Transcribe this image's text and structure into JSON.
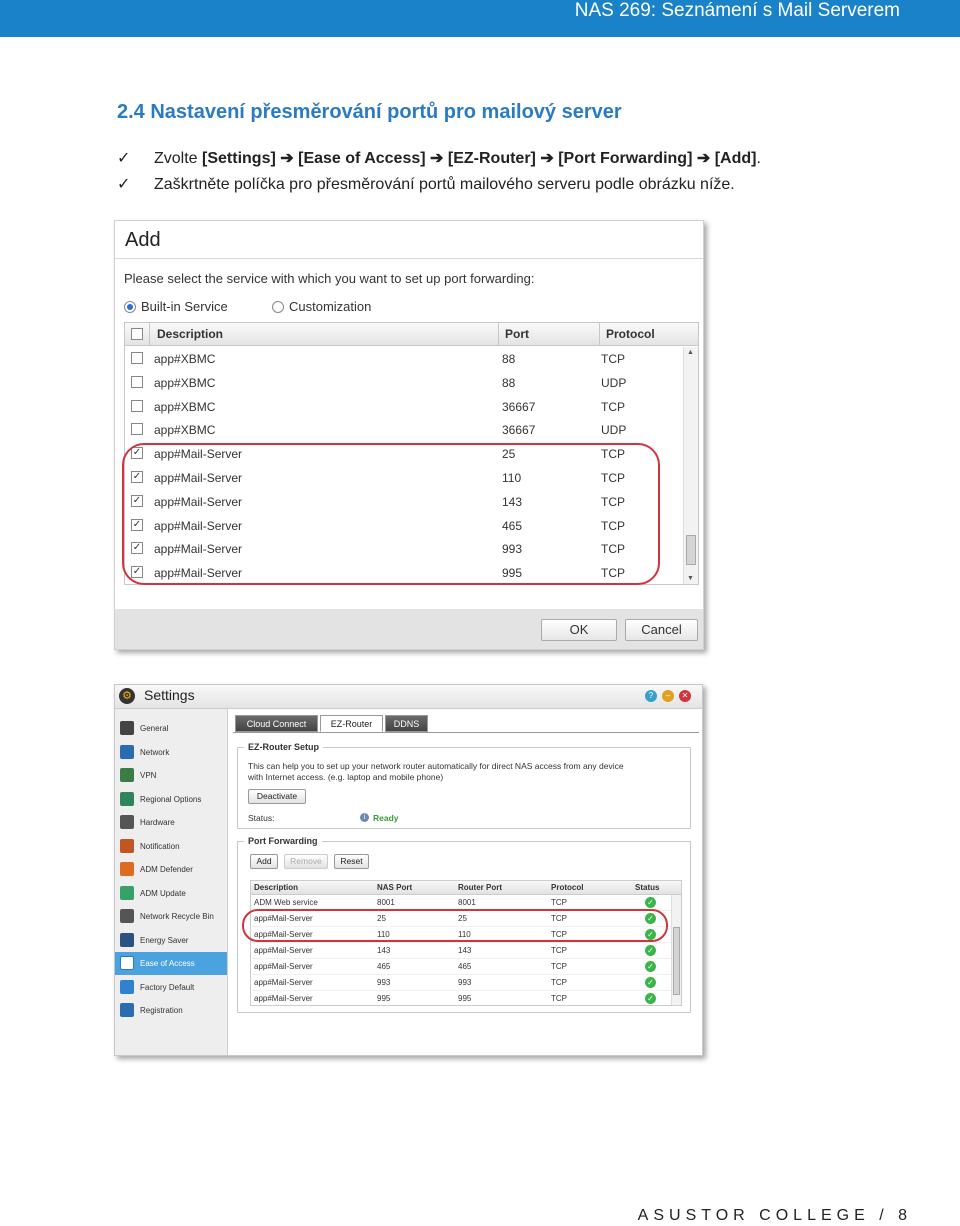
{
  "header": {
    "title": "NAS 269: Seznámení s Mail Serverem"
  },
  "section": {
    "title": "2.4 Nastavení přesměrování portů pro mailový server"
  },
  "bullets": {
    "check_glyph": "✓",
    "b1_prefix": "Zvolte ",
    "b1_settings": "[Settings]",
    "b1_ease": "[Ease of Access]",
    "b1_ez": "[EZ-Router]",
    "b1_pf": "[Port Forwarding]",
    "b1_add": "[Add]",
    "b1_suffix": ".",
    "arrow": "➔",
    "b2": "Zaškrtněte políčka pro přesměrování portů mailového serveru podle obrázku níže."
  },
  "add_dialog": {
    "title": "Add",
    "prompt": "Please select the service with which you want to set up port forwarding:",
    "radio_builtin": "Built-in Service",
    "radio_custom": "Customization",
    "columns": {
      "description": "Description",
      "port": "Port",
      "protocol": "Protocol"
    },
    "rows": [
      {
        "description": "app#XBMC",
        "port": "88",
        "protocol": "TCP",
        "checked": false
      },
      {
        "description": "app#XBMC",
        "port": "88",
        "protocol": "UDP",
        "checked": false
      },
      {
        "description": "app#XBMC",
        "port": "36667",
        "protocol": "TCP",
        "checked": false
      },
      {
        "description": "app#XBMC",
        "port": "36667",
        "protocol": "UDP",
        "checked": false
      },
      {
        "description": "app#Mail-Server",
        "port": "25",
        "protocol": "TCP",
        "checked": true
      },
      {
        "description": "app#Mail-Server",
        "port": "110",
        "protocol": "TCP",
        "checked": true
      },
      {
        "description": "app#Mail-Server",
        "port": "143",
        "protocol": "TCP",
        "checked": true
      },
      {
        "description": "app#Mail-Server",
        "port": "465",
        "protocol": "TCP",
        "checked": true
      },
      {
        "description": "app#Mail-Server",
        "port": "993",
        "protocol": "TCP",
        "checked": true
      },
      {
        "description": "app#Mail-Server",
        "port": "995",
        "protocol": "TCP",
        "checked": true
      }
    ],
    "ok_label": "OK",
    "cancel_label": "Cancel"
  },
  "settings": {
    "title": "Settings",
    "sidebar": [
      {
        "label": "General",
        "color": "#444444"
      },
      {
        "label": "Network",
        "color": "#2b6cb0"
      },
      {
        "label": "VPN",
        "color": "#3a7d44"
      },
      {
        "label": "Regional Options",
        "color": "#2f855a"
      },
      {
        "label": "Hardware",
        "color": "#555555"
      },
      {
        "label": "Notification",
        "color": "#c05621"
      },
      {
        "label": "ADM Defender",
        "color": "#dd6b20"
      },
      {
        "label": "ADM Update",
        "color": "#38a169"
      },
      {
        "label": "Network Recycle Bin",
        "color": "#555555"
      },
      {
        "label": "Energy Saver",
        "color": "#2c5282"
      },
      {
        "label": "Ease of Access",
        "color": "#ffffff"
      },
      {
        "label": "Factory Default",
        "color": "#3182ce"
      },
      {
        "label": "Registration",
        "color": "#2b6cb0"
      }
    ],
    "tabs": [
      "Cloud Connect",
      "EZ-Router",
      "DDNS"
    ],
    "ez_legend": "EZ-Router Setup",
    "ez_desc1": "This can help you to set up your network router automatically for direct NAS access from any device",
    "ez_desc2": "with Internet access. (e.g. laptop and mobile phone)",
    "deactivate_label": "Deactivate",
    "status_label": "Status:",
    "status_value": "Ready",
    "pf_legend": "Port Forwarding",
    "add_label": "Add",
    "remove_label": "Remove",
    "reset_label": "Reset",
    "pf_columns": {
      "description": "Description",
      "nas_port": "NAS Port",
      "router_port": "Router Port",
      "protocol": "Protocol",
      "status": "Status"
    },
    "pf_rows": [
      {
        "description": "ADM Web service",
        "nas_port": "8001",
        "router_port": "8001",
        "protocol": "TCP"
      },
      {
        "description": "app#Mail-Server",
        "nas_port": "25",
        "router_port": "25",
        "protocol": "TCP"
      },
      {
        "description": "app#Mail-Server",
        "nas_port": "110",
        "router_port": "110",
        "protocol": "TCP"
      },
      {
        "description": "app#Mail-Server",
        "nas_port": "143",
        "router_port": "143",
        "protocol": "TCP"
      },
      {
        "description": "app#Mail-Server",
        "nas_port": "465",
        "router_port": "465",
        "protocol": "TCP"
      },
      {
        "description": "app#Mail-Server",
        "nas_port": "993",
        "router_port": "993",
        "protocol": "TCP"
      },
      {
        "description": "app#Mail-Server",
        "nas_port": "995",
        "router_port": "995",
        "protocol": "TCP"
      }
    ]
  },
  "footer": {
    "text": "ASUSTOR COLLEGE / 8"
  },
  "colors": {
    "accent": "#1a82c8",
    "highlight": "#d0343d",
    "ok": "#3bb54a"
  }
}
